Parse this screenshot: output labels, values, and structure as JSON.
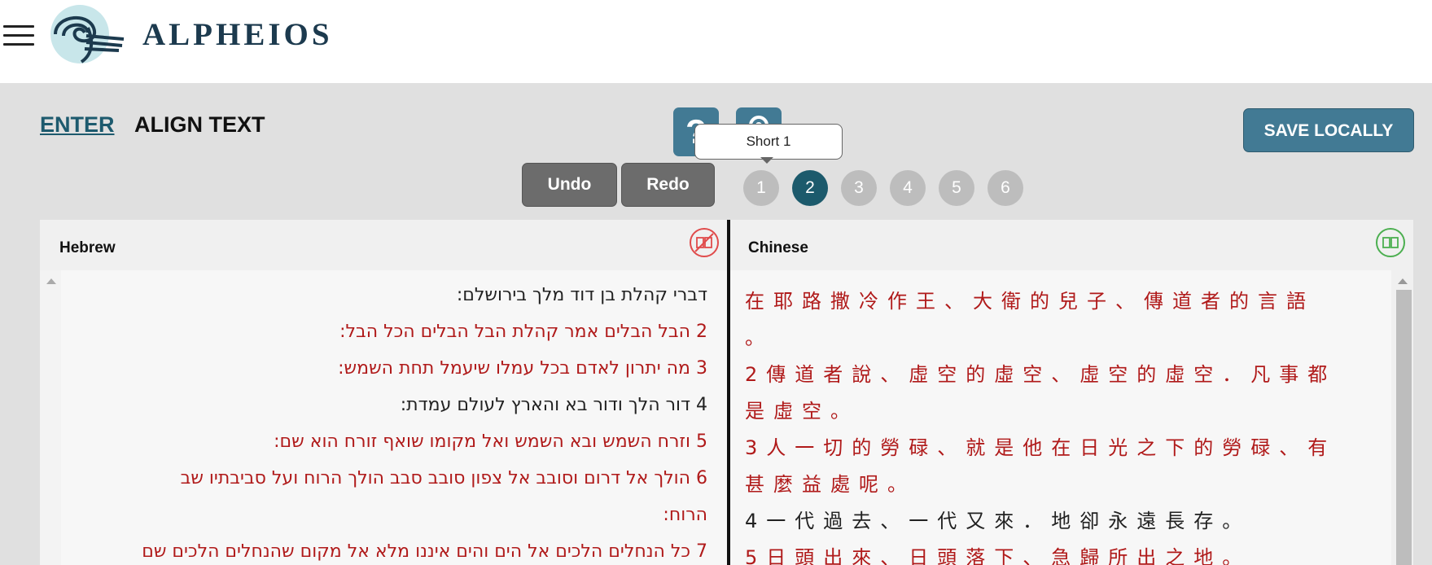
{
  "header": {
    "menu_icon": "hamburger-menu-icon",
    "logo_icon": "alpheios-logo-icon",
    "logo_text": "ALPHEIOS"
  },
  "nav": {
    "enter": "ENTER",
    "align_text": "ALIGN TEXT"
  },
  "toolbar": {
    "help_label": "?",
    "help_icon": "question-icon",
    "settings_icon": "gear-icon",
    "tooltip": "Short 1",
    "save_label": "SAVE LOCALLY",
    "undo_label": "Undo",
    "redo_label": "Redo"
  },
  "steps": [
    {
      "label": "1",
      "active": false
    },
    {
      "label": "2",
      "active": true
    },
    {
      "label": "3",
      "active": false
    },
    {
      "label": "4",
      "active": false
    },
    {
      "label": "5",
      "active": false
    },
    {
      "label": "6",
      "active": false
    }
  ],
  "left_panel": {
    "title": "Hebrew",
    "toggle_icon": "book-disabled-icon",
    "lines": [
      "דברי קהלת בן דוד מלך בירושלם:",
      "2 הבל הבלים אמר קהלת הבל הבלים הכל הבל:",
      "3 מה יתרון לאדם בכל עמלו שיעמל תחת השמש:",
      "4 דור הלך ודור בא והארץ לעולם עמדת:",
      "5 וזרח השמש ובא השמש ואל מקומו שואף זורח הוא שם:",
      "6 הולך אל דרום וסובב אל צפון סובב סבב הולך הרוח ועל סביבתיו שב",
      "הרוח:",
      "7 כל הנחלים הלכים אל הים והים איננו מלא אל מקום שהנחלים הלכים שם"
    ]
  },
  "right_panel": {
    "title": "Chinese",
    "toggle_icon": "book-enabled-icon",
    "lines": [
      "在耶路撒冷作王、大衛的兒子、傳道者的言語",
      "。",
      "2傳道者說、虛空的虛空、虛空的虛空．凡事都",
      "是虛空。",
      "3人一切的勞碌、就是他在日光之下的勞碌、有",
      "甚麼益處呢。",
      "4一代過去、一代又來．地卻永遠長存。",
      "5日頭出來、日頭落下、急歸所出之地。"
    ]
  },
  "colors": {
    "accent": "#427a94",
    "active_step": "#1c5a6c",
    "aligned_text": "#b01a1a"
  }
}
